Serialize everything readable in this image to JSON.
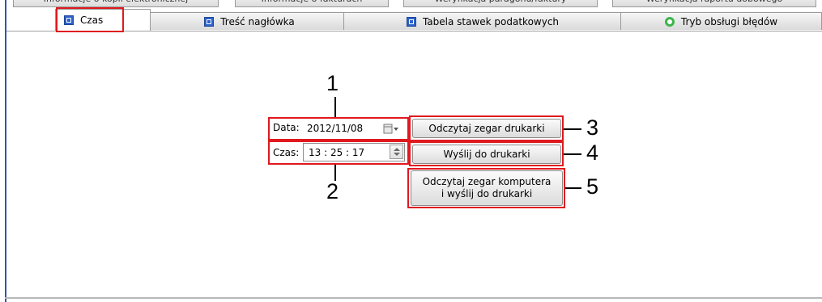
{
  "window": {
    "background_tabs": [
      "Informacje o kopii elektronicznej",
      "Informacje o fakturach",
      "Weryfikacja paragonu/faktury",
      "Weryfikacja raportu dobowego"
    ]
  },
  "tabs": [
    {
      "label": "Czas",
      "icon": "blue-square-icon",
      "active": true
    },
    {
      "label": "Treść nagłówka",
      "icon": "blue-square-icon",
      "active": false
    },
    {
      "label": "Tabela stawek podatkowych",
      "icon": "blue-square-icon",
      "active": false
    },
    {
      "label": "Tryb obsługi błędów",
      "icon": "green-ring-icon",
      "active": false
    }
  ],
  "form": {
    "date_label": "Data:",
    "date_value": "2012/11/08",
    "time_label": "Czas:",
    "time_value": "13 : 25 : 17"
  },
  "buttons": {
    "read_clock": "Odczytaj zegar drukarki",
    "send": "Wyślij do drukarki",
    "read_pc_line1": "Odczytaj zegar komputera",
    "read_pc_line2": "i wyślij do drukarki"
  },
  "callouts": [
    "1",
    "2",
    "3",
    "4",
    "5"
  ],
  "colors": {
    "highlight": "#e0191f",
    "tab_icon_blue": "#2e62c9",
    "tab_icon_green": "#3cb54a"
  }
}
